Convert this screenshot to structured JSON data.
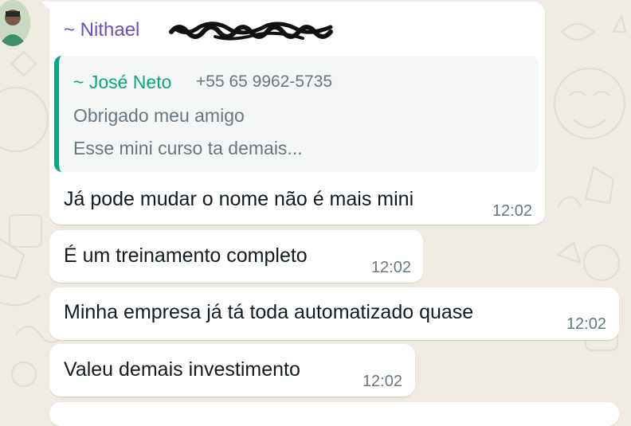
{
  "chat": {
    "sender_name": "~ Nithael",
    "quoted": {
      "author": "~ José Neto",
      "phone": "+55 65 9962-5735",
      "line1": "Obrigado meu amigo",
      "line2": "Esse mini curso ta demais..."
    },
    "messages": [
      {
        "text": "Já pode mudar o nome não é mais mini",
        "time": "12:02"
      },
      {
        "text": "É um treinamento completo",
        "time": "12:02"
      },
      {
        "text": "Minha empresa já tá toda automatizado quase",
        "time": "12:02"
      },
      {
        "text": "Valeu demais investimento",
        "time": "12:02"
      }
    ]
  },
  "colors": {
    "background": "#efeae2",
    "bubble": "#ffffff",
    "sender_name": "#6b4fbb",
    "quote_accent": "#06a884",
    "time_text": "#667781"
  },
  "icons": {
    "avatar": "user-avatar",
    "redaction": "redaction-scribble"
  }
}
